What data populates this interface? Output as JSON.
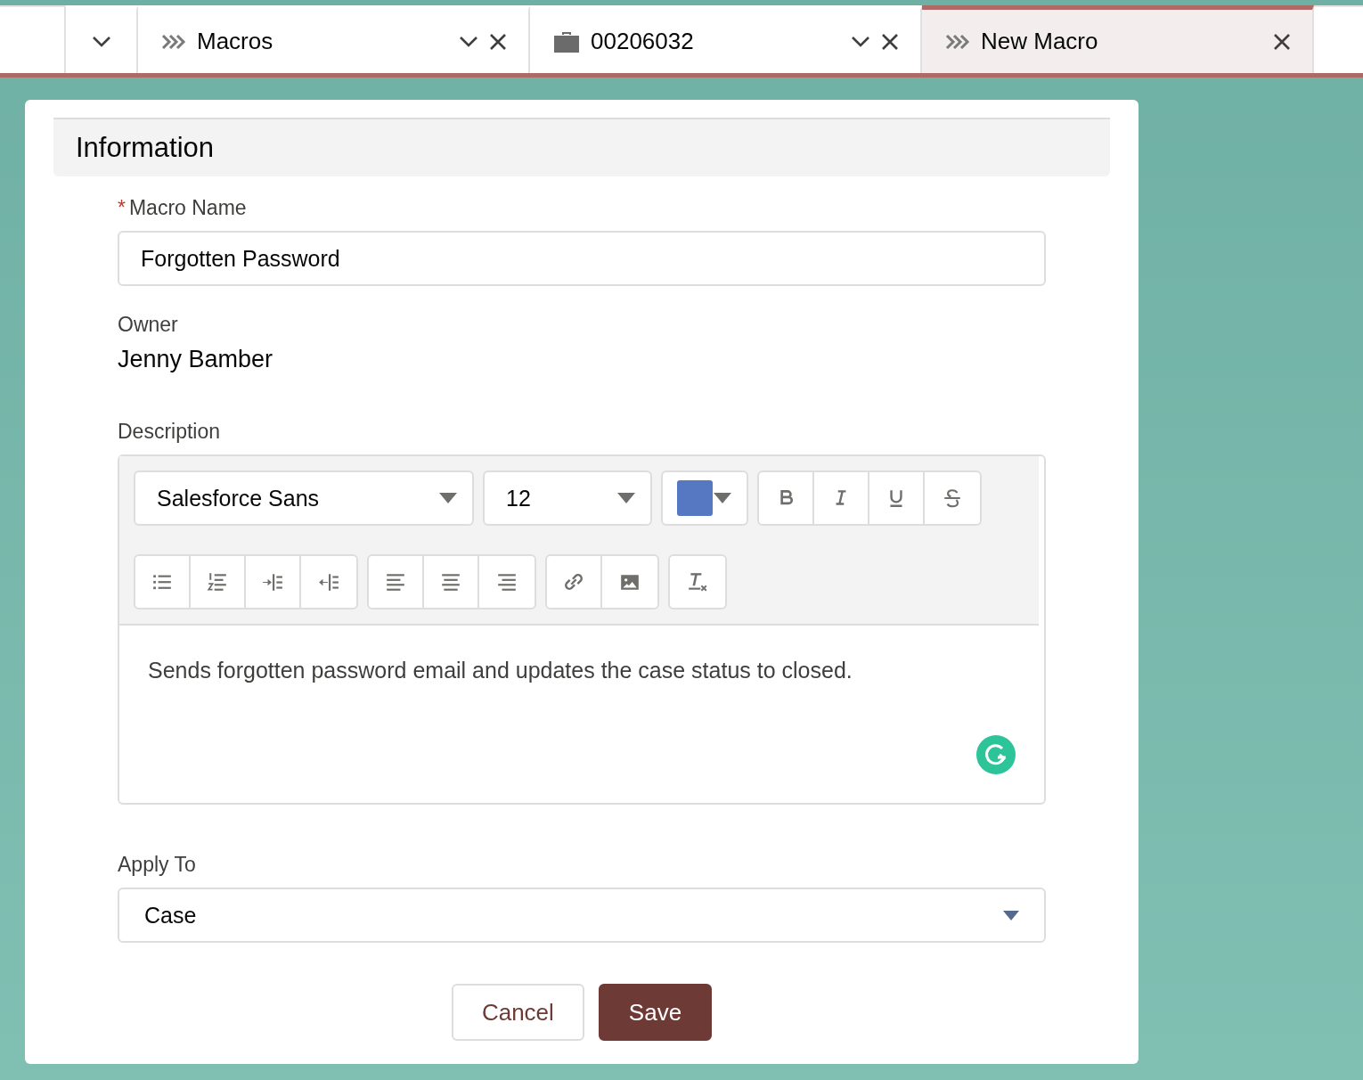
{
  "tabs": [
    {
      "kind": "menu",
      "selected": false
    },
    {
      "kind": "macro",
      "label": "Macros",
      "has_menu": true,
      "selected": false
    },
    {
      "kind": "case",
      "label": "00206032",
      "has_menu": true,
      "selected": false
    },
    {
      "kind": "macro",
      "label": "New Macro",
      "has_menu": false,
      "selected": true
    }
  ],
  "section": {
    "title": "Information"
  },
  "macro_name": {
    "required_mark": "*",
    "label": "Macro Name",
    "value": "Forgotten Password"
  },
  "owner": {
    "label": "Owner",
    "value": "Jenny Bamber"
  },
  "description": {
    "label": "Description",
    "toolbar": {
      "font": "Salesforce Sans",
      "size": "12",
      "color": "#5677c1",
      "groups": [
        [
          {
            "kind": "bold"
          },
          {
            "kind": "italic"
          },
          {
            "kind": "underline"
          },
          {
            "kind": "strike"
          }
        ],
        [
          {
            "kind": "bullets"
          },
          {
            "kind": "numbers"
          },
          {
            "kind": "indent"
          },
          {
            "kind": "outdent"
          }
        ],
        [
          {
            "kind": "left"
          },
          {
            "kind": "center"
          },
          {
            "kind": "right"
          }
        ],
        [
          {
            "kind": "link"
          },
          {
            "kind": "image"
          }
        ],
        [
          {
            "kind": "clear"
          }
        ]
      ]
    },
    "text": "Sends forgotten password email and updates the case status to closed."
  },
  "apply_to": {
    "label": "Apply To",
    "value": "Case"
  },
  "buttons": [
    {
      "kind": "neutral",
      "label": "Cancel"
    },
    {
      "kind": "brand",
      "label": "Save"
    }
  ]
}
